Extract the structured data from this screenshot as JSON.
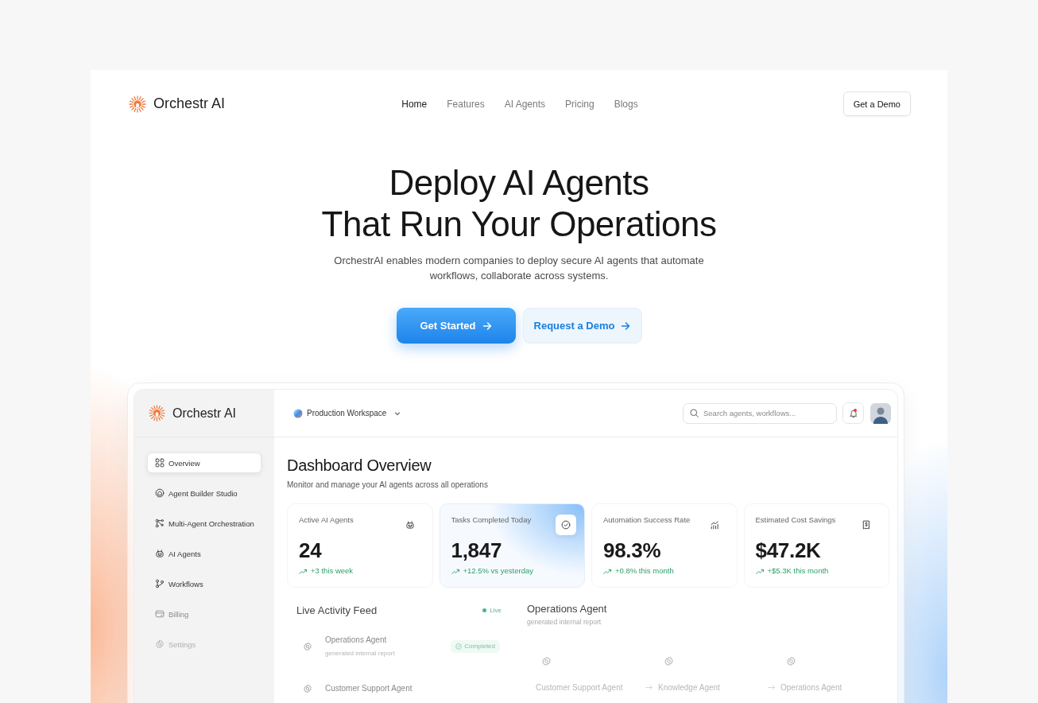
{
  "nav": {
    "brand": "Orchestr AI",
    "links": [
      {
        "label": "Home",
        "selected": true
      },
      {
        "label": "Features",
        "selected": false
      },
      {
        "label": "AI Agents",
        "selected": false
      },
      {
        "label": "Pricing",
        "selected": false
      },
      {
        "label": "Blogs",
        "selected": false
      }
    ],
    "cta": "Get a Demo"
  },
  "hero": {
    "title_lines": [
      "Deploy AI Agents",
      "That Run Your Operations"
    ],
    "subtitle": "OrchestrAI enables modern companies to deploy secure AI agents that automate workflows, collaborate across systems.",
    "buttons": [
      {
        "label": "Get Started",
        "kind": "primary"
      },
      {
        "label": "Request a Demo",
        "kind": "secondary"
      }
    ]
  },
  "dashboard": {
    "brand": "Orchestr AI",
    "workspace": "Production Workspace",
    "search": {
      "placeholder": "Search agents, workflows..."
    },
    "notifications": {
      "unread": true
    },
    "sidebar": {
      "items": [
        {
          "label": "Overview",
          "selected": true
        },
        {
          "label": "Agent Builder Studio",
          "selected": false
        },
        {
          "label": "Multi-Agent Orchestration",
          "selected": false
        },
        {
          "label": "AI Agents",
          "selected": false
        },
        {
          "label": "Workflows",
          "selected": false
        },
        {
          "label": "Billing",
          "selected": false
        },
        {
          "label": "Settings",
          "selected": false
        }
      ]
    },
    "title": "Dashboard Overview",
    "subtitle": "Monitor and manage your AI agents across all operations",
    "stats": [
      {
        "label": "Active AI Agents",
        "value": "24",
        "trend": "+3 this week",
        "highlighted": false
      },
      {
        "label": "Tasks Completed Today",
        "value": "1,847",
        "trend": "+12.5% vs yesterday",
        "highlighted": true
      },
      {
        "label": "Automation Success Rate",
        "value": "98.3%",
        "trend": "+0.8% this month",
        "highlighted": false
      },
      {
        "label": "Estimated Cost Savings",
        "value": "$47.2K",
        "trend": "+$5.3K this month",
        "highlighted": false
      }
    ],
    "activity_feed": {
      "title": "Live Activity Feed",
      "status": "Live",
      "items": [
        {
          "agent": "Operations Agent",
          "action": "generated internal report",
          "status": "Completed"
        },
        {
          "agent": "Customer Support Agent"
        }
      ]
    },
    "agent_detail": {
      "title": "Operations Agent",
      "subtitle": "generated internal report",
      "nodes": [
        {
          "label": "Customer Support Agent"
        },
        {
          "label": "Knowledge Agent"
        },
        {
          "label": "Operations Agent"
        }
      ]
    }
  }
}
